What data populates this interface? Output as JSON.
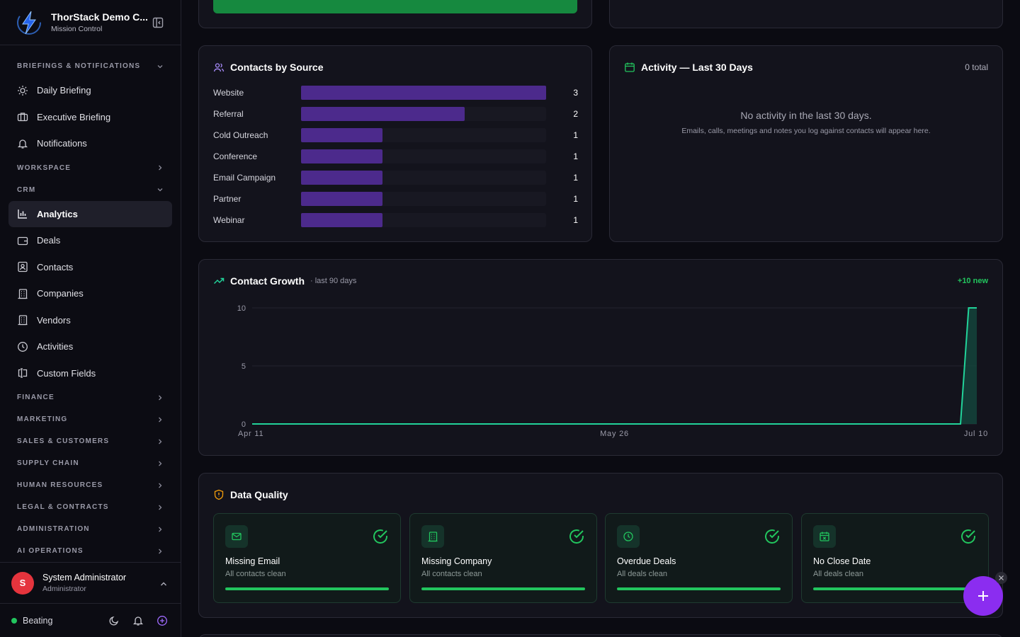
{
  "brand": {
    "title": "ThorStack Demo C...",
    "subtitle": "Mission Control"
  },
  "sidebar": {
    "sections": {
      "briefings": "BRIEFINGS & NOTIFICATIONS",
      "workspace": "WORKSPACE",
      "crm": "CRM",
      "finance": "FINANCE",
      "marketing": "MARKETING",
      "sales": "SALES & CUSTOMERS",
      "supply": "SUPPLY CHAIN",
      "hr": "HUMAN RESOURCES",
      "legal": "LEGAL & CONTRACTS",
      "admin": "ADMINISTRATION",
      "ai": "AI OPERATIONS"
    },
    "items": {
      "daily": "Daily Briefing",
      "executive": "Executive Briefing",
      "notifications": "Notifications",
      "analytics": "Analytics",
      "deals": "Deals",
      "contacts": "Contacts",
      "companies": "Companies",
      "vendors": "Vendors",
      "activities": "Activities",
      "custom_fields": "Custom Fields"
    }
  },
  "user": {
    "initial": "S",
    "name": "System Administrator",
    "role": "Administrator"
  },
  "status": {
    "label": "Beating"
  },
  "contacts_by_source": {
    "title": "Contacts by Source",
    "rows": [
      {
        "label": "Website",
        "value": 3
      },
      {
        "label": "Referral",
        "value": 2
      },
      {
        "label": "Cold Outreach",
        "value": 1
      },
      {
        "label": "Conference",
        "value": 1
      },
      {
        "label": "Email Campaign",
        "value": 1
      },
      {
        "label": "Partner",
        "value": 1
      },
      {
        "label": "Webinar",
        "value": 1
      }
    ]
  },
  "activity": {
    "title": "Activity — Last 30 Days",
    "total": "0 total",
    "empty_title": "No activity in the last 30 days.",
    "empty_sub": "Emails, calls, meetings and notes you log against contacts will appear here."
  },
  "growth": {
    "title": "Contact Growth",
    "subtitle": "· last 90 days",
    "badge": "+10 new"
  },
  "chart_data": {
    "type": "area",
    "title": "Contact Growth",
    "x_tick_labels": [
      "Apr 11",
      "May 26",
      "Jul 10"
    ],
    "y_ticks": [
      0,
      5,
      10
    ],
    "ylim": [
      0,
      10
    ],
    "series": [
      {
        "values": [
          0,
          0,
          0,
          0,
          0,
          0,
          0,
          0,
          0,
          0,
          0,
          0,
          0,
          0,
          0,
          0,
          0,
          0,
          0,
          0,
          0,
          0,
          0,
          0,
          0,
          0,
          0,
          0,
          0,
          0,
          0,
          0,
          0,
          0,
          0,
          0,
          0,
          0,
          0,
          0,
          0,
          0,
          0,
          0,
          0,
          0,
          0,
          0,
          0,
          0,
          0,
          0,
          0,
          0,
          0,
          0,
          0,
          0,
          0,
          0,
          0,
          0,
          0,
          0,
          0,
          0,
          0,
          0,
          0,
          0,
          0,
          0,
          0,
          0,
          0,
          0,
          0,
          0,
          0,
          0,
          0,
          0,
          0,
          0,
          0,
          0,
          0,
          0,
          10,
          10
        ]
      }
    ],
    "colors": {
      "line": "#22d39a",
      "fill": "#14473d"
    }
  },
  "data_quality": {
    "title": "Data Quality",
    "cards": [
      {
        "title": "Missing Email",
        "sub": "All contacts clean",
        "icon": "mail-icon"
      },
      {
        "title": "Missing Company",
        "sub": "All contacts clean",
        "icon": "building-icon"
      },
      {
        "title": "Overdue Deals",
        "sub": "All deals clean",
        "icon": "clock-icon"
      },
      {
        "title": "No Close Date",
        "sub": "All deals clean",
        "icon": "calendar-x-icon"
      }
    ]
  },
  "colors": {
    "accent": "#8b2df0",
    "success": "#22c55e",
    "bar": "#4c2a8c",
    "green_button": "#16893f"
  }
}
